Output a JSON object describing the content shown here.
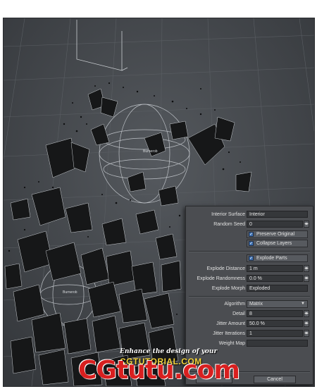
{
  "panel": {
    "interior_surface": {
      "label": "Interior Surface",
      "value": "Interior"
    },
    "random_seed": {
      "label": "Random Seed",
      "value": "0"
    },
    "preserve_original": {
      "label": "Preserve Original",
      "checked": true
    },
    "collapse_layers": {
      "label": "Collapse Layers",
      "checked": true
    },
    "explode_parts": {
      "label": "Explode Parts",
      "checked": true
    },
    "explode_distance": {
      "label": "Explode Distance",
      "value": "1 m"
    },
    "explode_randomness": {
      "label": "Explode Randomness",
      "value": "0.0 %"
    },
    "explode_morph": {
      "label": "Explode Morph",
      "value": "Exploded"
    },
    "algorithm": {
      "label": "Algorithm",
      "value": "Matrix"
    },
    "detail": {
      "label": "Detail",
      "value": "8"
    },
    "jitter_amount": {
      "label": "Jitter Amount",
      "value": "50.0 %"
    },
    "jitter_iterations": {
      "label": "Jitter Iterations",
      "value": "1"
    },
    "weight_map": {
      "label": "Weight Map",
      "value": ""
    },
    "cancel_label": "Cancel"
  },
  "viewport": {
    "label_a": "Burnerob",
    "label_b": "Burnerob"
  },
  "promo": {
    "line1": "Enhance the design of your",
    "line2": "CGTUTORIAL.COM"
  },
  "watermark": "CGtutu.com"
}
